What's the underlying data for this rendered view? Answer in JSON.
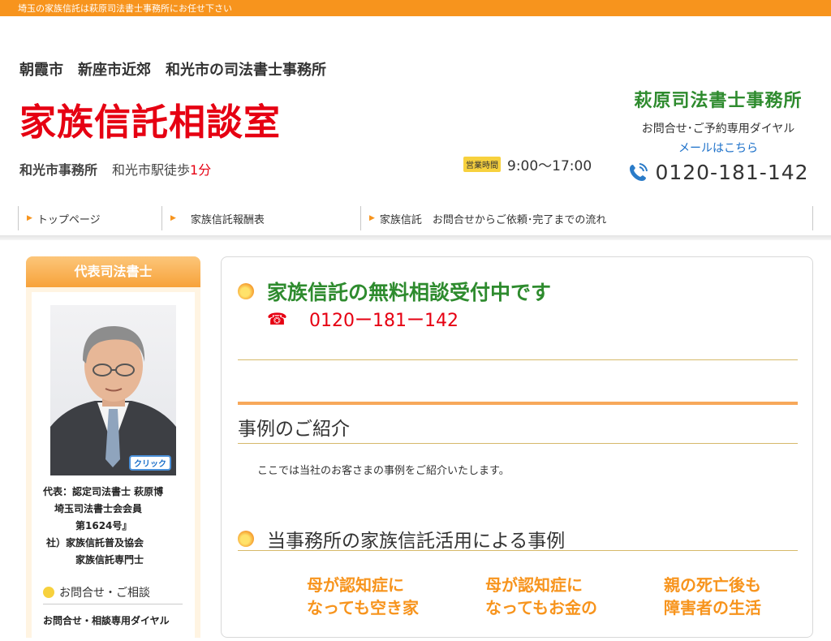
{
  "topbar": {
    "text": "埼玉の家族信託は萩原司法書士事務所にお任せ下さい"
  },
  "header": {
    "area_line": "朝霞市　新座市近郊　和光市の司法書士事務所",
    "site_title": "家族信託相談室",
    "office_label": "和光市事務所",
    "access_text": "和光市駅徒歩",
    "access_minutes": "1分",
    "hours_badge": "営業時間",
    "hours": "9:00〜17:00",
    "office_name": "萩原司法書士事務所",
    "dial_label": "お問合せ･ご予約専用ダイヤル",
    "mail_link": "メールはこちら",
    "phone": "0120-181-142"
  },
  "nav": {
    "items": [
      {
        "label": "トップページ"
      },
      {
        "label": "家族信託報酬表"
      },
      {
        "label": "家族信託　お問合せからご依頼･完了までの流れ"
      }
    ]
  },
  "sidebar": {
    "heading": "代表司法書士",
    "click_label": "クリック",
    "profile": [
      "代表：認定司法書士 萩原博",
      "埼玉司法書士会会員",
      "第1624号』",
      "社）家族信託普及協会",
      "家族信託専門士"
    ],
    "inquiry_heading": "お問合せ・ご相談",
    "inquiry_sub": "お問合せ・相談専用ダイヤル"
  },
  "main": {
    "free_title": "家族信託の無料相談受付中です",
    "free_phone": "0120ー181ー142",
    "cases_title": "事例のご紹介",
    "cases_desc": "ここでは当社のお客さまの事例をご紹介いたします。",
    "our_title": "当事務所の家族信託活用による事例",
    "cases": [
      {
        "line1": "母が認知症に",
        "line2": "なっても空き家"
      },
      {
        "line1": "母が認知症に",
        "line2": "なってもお金の"
      },
      {
        "line1": "親の死亡後も",
        "line2": "障害者の生活"
      }
    ]
  },
  "colors": {
    "accent_orange": "#f7941d",
    "title_red": "#e60012",
    "office_green": "#2e8b2e",
    "link_blue": "#1a6fc9"
  },
  "icons": [
    "phone-icon",
    "telephone-icon",
    "arrow-icon",
    "orange-circle-icon",
    "portrait-photo"
  ]
}
